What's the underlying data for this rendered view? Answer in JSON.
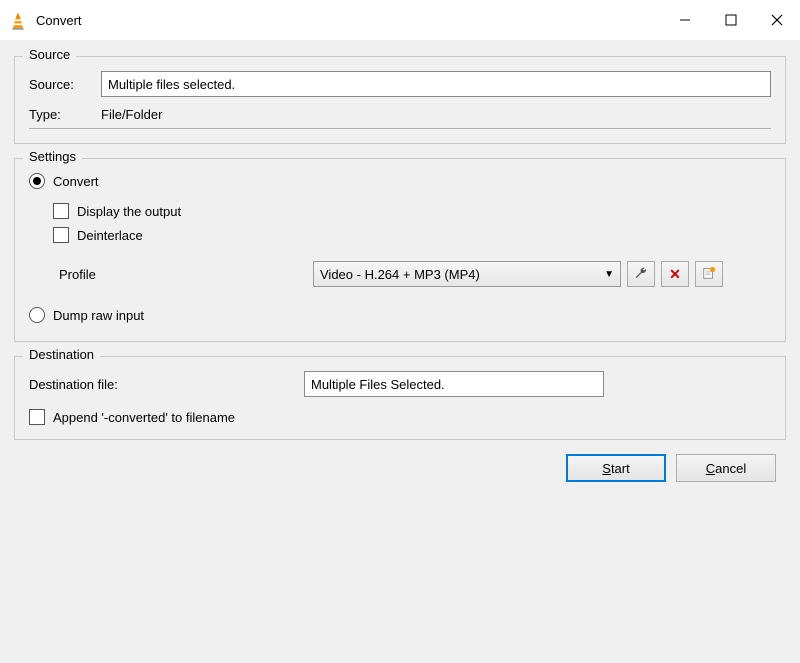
{
  "window": {
    "title": "Convert"
  },
  "source_group": {
    "legend": "Source",
    "source_label": "Source:",
    "source_value": "Multiple files selected.",
    "type_label": "Type:",
    "type_value": "File/Folder"
  },
  "settings_group": {
    "legend": "Settings",
    "convert_radio": "Convert",
    "display_output": "Display the output",
    "deinterlace": "Deinterlace",
    "profile_label": "Profile",
    "profile_value": "Video - H.264 + MP3 (MP4)",
    "dump_raw": "Dump raw input"
  },
  "destination_group": {
    "legend": "Destination",
    "dest_file_label": "Destination file:",
    "dest_file_value": "Multiple Files Selected.",
    "append_label": "Append '-converted' to filename"
  },
  "footer": {
    "start": "Start",
    "cancel": "Cancel"
  },
  "icons": {
    "wrench": "wrench",
    "delete": "delete",
    "new_profile": "new-profile"
  }
}
